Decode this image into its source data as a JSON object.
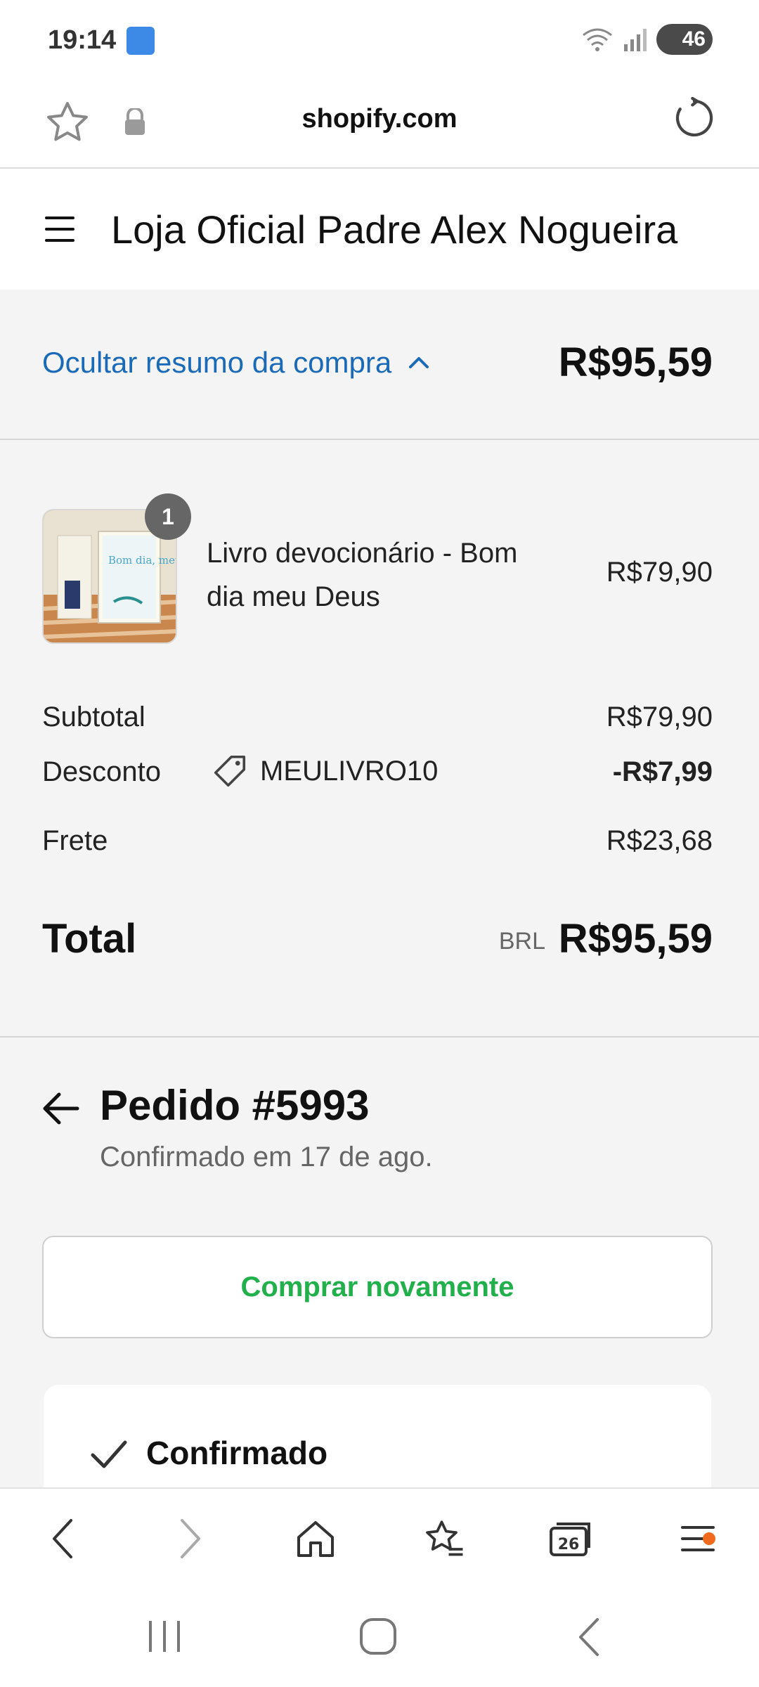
{
  "status_bar": {
    "time": "19:14",
    "battery": "46"
  },
  "browser": {
    "url": "shopify.com"
  },
  "shop": {
    "title": "Loja Oficial Padre Alex Nogueira"
  },
  "summary": {
    "toggle_label": "Ocultar resumo da compra",
    "total": "R$95,59"
  },
  "item": {
    "quantity": "1",
    "name": "Livro devocionário - Bom dia meu Deus",
    "price": "R$79,90",
    "thumb_text": "Bom dia, meu Deus"
  },
  "totals": {
    "subtotal_label": "Subtotal",
    "subtotal_value": "R$79,90",
    "discount_label": "Desconto",
    "discount_code": "MEULIVRO10",
    "discount_value": "-R$7,99",
    "shipping_label": "Frete",
    "shipping_value": "R$23,68",
    "total_label": "Total",
    "currency": "BRL",
    "total_value": "R$95,59"
  },
  "order": {
    "title": "Pedido #5993",
    "subtitle": "Confirmado em 17 de ago.",
    "buy_again": "Comprar novamente",
    "status_label": "Confirmado"
  },
  "bottom_nav": {
    "tabs_count": "26"
  },
  "colors": {
    "link": "#1a6ab8",
    "buy_again": "#21b04b",
    "notification": "#f06a1d"
  }
}
